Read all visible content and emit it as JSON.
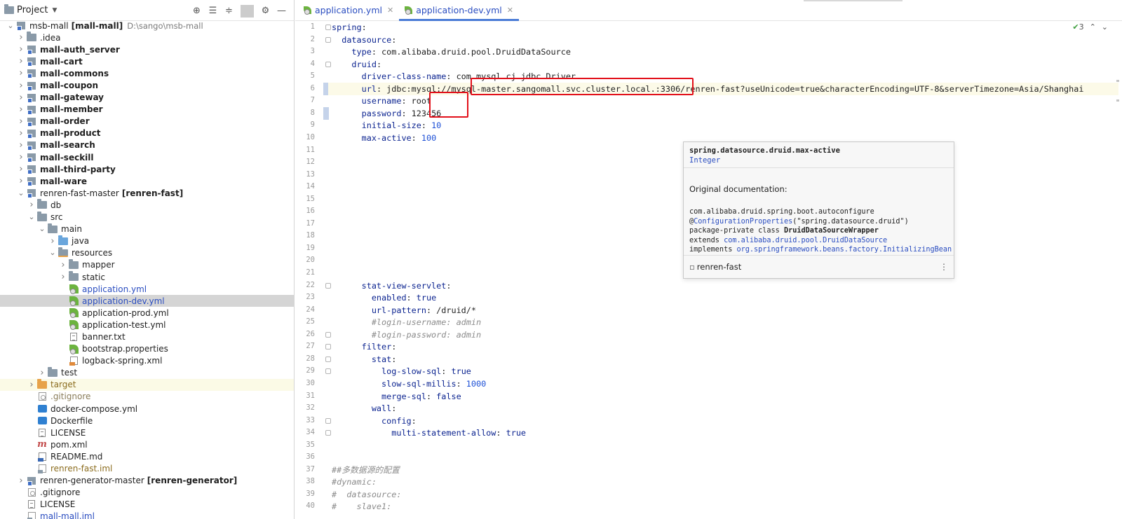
{
  "project_panel": {
    "title": "Project",
    "tools": [
      "locate-icon",
      "expand-all-icon",
      "collapse-all-icon",
      "gear-icon",
      "hide-icon"
    ],
    "tree": [
      {
        "depth": 0,
        "arrow": "open",
        "icon": "module",
        "label": "msb-mall",
        "extra": "[mall-mall]",
        "path": "D:\\sango\\msb-mall",
        "style": ""
      },
      {
        "depth": 1,
        "arrow": "closed",
        "icon": "folder",
        "label": ".idea",
        "style": ""
      },
      {
        "depth": 1,
        "arrow": "closed",
        "icon": "module",
        "label": "mall-auth_server",
        "style": "bold"
      },
      {
        "depth": 1,
        "arrow": "closed",
        "icon": "module",
        "label": "mall-cart",
        "style": "bold"
      },
      {
        "depth": 1,
        "arrow": "closed",
        "icon": "module",
        "label": "mall-commons",
        "style": "bold"
      },
      {
        "depth": 1,
        "arrow": "closed",
        "icon": "module",
        "label": "mall-coupon",
        "style": "bold"
      },
      {
        "depth": 1,
        "arrow": "closed",
        "icon": "module",
        "label": "mall-gateway",
        "style": "bold"
      },
      {
        "depth": 1,
        "arrow": "closed",
        "icon": "module",
        "label": "mall-member",
        "style": "bold"
      },
      {
        "depth": 1,
        "arrow": "closed",
        "icon": "module",
        "label": "mall-order",
        "style": "bold"
      },
      {
        "depth": 1,
        "arrow": "closed",
        "icon": "module",
        "label": "mall-product",
        "style": "bold"
      },
      {
        "depth": 1,
        "arrow": "closed",
        "icon": "module",
        "label": "mall-search",
        "style": "bold"
      },
      {
        "depth": 1,
        "arrow": "closed",
        "icon": "module",
        "label": "mall-seckill",
        "style": "bold"
      },
      {
        "depth": 1,
        "arrow": "closed",
        "icon": "module",
        "label": "mall-third-party",
        "style": "bold"
      },
      {
        "depth": 1,
        "arrow": "closed",
        "icon": "module",
        "label": "mall-ware",
        "style": "bold"
      },
      {
        "depth": 1,
        "arrow": "open",
        "icon": "module",
        "label": "renren-fast-master",
        "extra": "[renren-fast]",
        "style": ""
      },
      {
        "depth": 2,
        "arrow": "closed",
        "icon": "folder",
        "label": "db",
        "style": ""
      },
      {
        "depth": 2,
        "arrow": "open",
        "icon": "folder",
        "label": "src",
        "style": ""
      },
      {
        "depth": 3,
        "arrow": "open",
        "icon": "folder",
        "label": "main",
        "style": ""
      },
      {
        "depth": 4,
        "arrow": "closed",
        "icon": "folder-blue",
        "label": "java",
        "style": ""
      },
      {
        "depth": 4,
        "arrow": "open",
        "icon": "folder-res",
        "label": "resources",
        "style": ""
      },
      {
        "depth": 5,
        "arrow": "closed",
        "icon": "folder",
        "label": "mapper",
        "style": ""
      },
      {
        "depth": 5,
        "arrow": "closed",
        "icon": "folder",
        "label": "static",
        "style": ""
      },
      {
        "depth": 5,
        "arrow": "none",
        "icon": "leaf",
        "label": "application.yml",
        "style": "blue"
      },
      {
        "depth": 5,
        "arrow": "none",
        "icon": "leaf",
        "label": "application-dev.yml",
        "style": "blue",
        "selected": true
      },
      {
        "depth": 5,
        "arrow": "none",
        "icon": "leaf",
        "label": "application-prod.yml",
        "style": ""
      },
      {
        "depth": 5,
        "arrow": "none",
        "icon": "leaf",
        "label": "application-test.yml",
        "style": ""
      },
      {
        "depth": 5,
        "arrow": "none",
        "icon": "txt",
        "label": "banner.txt",
        "style": ""
      },
      {
        "depth": 5,
        "arrow": "none",
        "icon": "leaf",
        "label": "bootstrap.properties",
        "style": ""
      },
      {
        "depth": 5,
        "arrow": "none",
        "icon": "xml",
        "label": "logback-spring.xml",
        "style": ""
      },
      {
        "depth": 3,
        "arrow": "closed",
        "icon": "folder",
        "label": "test",
        "style": ""
      },
      {
        "depth": 2,
        "arrow": "closed",
        "icon": "folder-orange",
        "label": "target",
        "style": "brown",
        "excluded": true
      },
      {
        "depth": 2,
        "arrow": "none",
        "icon": "git",
        "label": ".gitignore",
        "style": "gitignored"
      },
      {
        "depth": 2,
        "arrow": "none",
        "icon": "docker",
        "label": "docker-compose.yml",
        "style": ""
      },
      {
        "depth": 2,
        "arrow": "none",
        "icon": "docker",
        "label": "Dockerfile",
        "style": ""
      },
      {
        "depth": 2,
        "arrow": "none",
        "icon": "txt",
        "label": "LICENSE",
        "style": ""
      },
      {
        "depth": 2,
        "arrow": "none",
        "icon": "maven",
        "label": "pom.xml",
        "style": ""
      },
      {
        "depth": 2,
        "arrow": "none",
        "icon": "md",
        "label": "README.md",
        "style": ""
      },
      {
        "depth": 2,
        "arrow": "none",
        "icon": "iml",
        "label": "renren-fast.iml",
        "style": "brown"
      },
      {
        "depth": 1,
        "arrow": "closed",
        "icon": "module",
        "label": "renren-generator-master",
        "extra": "[renren-generator]",
        "style": ""
      },
      {
        "depth": 1,
        "arrow": "none",
        "icon": "git",
        "label": ".gitignore",
        "style": ""
      },
      {
        "depth": 1,
        "arrow": "none",
        "icon": "txt",
        "label": "LICENSE",
        "style": ""
      },
      {
        "depth": 1,
        "arrow": "none",
        "icon": "iml",
        "label": "mall-mall.iml",
        "style": "blue"
      }
    ]
  },
  "editor": {
    "tabs": [
      {
        "label": "application.yml",
        "active": false
      },
      {
        "label": "application-dev.yml",
        "active": true
      }
    ],
    "inspection": {
      "count": "3"
    },
    "lines": [
      {
        "n": "1",
        "segs": [
          [
            "k",
            "spring"
          ],
          [
            "v",
            ":"
          ]
        ]
      },
      {
        "n": "2",
        "segs": [
          [
            "v",
            "  "
          ],
          [
            "k",
            "datasource"
          ],
          [
            "v",
            ":"
          ]
        ]
      },
      {
        "n": "3",
        "segs": [
          [
            "v",
            "    "
          ],
          [
            "k",
            "type"
          ],
          [
            "v",
            ": com.alibaba.druid.pool.DruidDataSource"
          ]
        ]
      },
      {
        "n": "4",
        "segs": [
          [
            "v",
            "    "
          ],
          [
            "k",
            "druid"
          ],
          [
            "v",
            ":"
          ]
        ]
      },
      {
        "n": "5",
        "segs": [
          [
            "v",
            "      "
          ],
          [
            "k",
            "driver-class-name"
          ],
          [
            "v",
            ": com.mysql.cj.jdbc.Driver"
          ]
        ]
      },
      {
        "n": "6",
        "segs": [
          [
            "v",
            "      "
          ],
          [
            "k",
            "url"
          ],
          [
            "v",
            ": jdbc:mysql://mysql-master.sangomall.svc.cluster.local.:3306/renren-fast?useUnicode=true&characterEncoding=UTF-8&serverTimezone=Asia/Shanghai"
          ]
        ],
        "current": true
      },
      {
        "n": "7",
        "segs": [
          [
            "v",
            "      "
          ],
          [
            "k",
            "username"
          ],
          [
            "v",
            ": root"
          ]
        ]
      },
      {
        "n": "8",
        "segs": [
          [
            "v",
            "      "
          ],
          [
            "k",
            "password"
          ],
          [
            "v",
            ": 123456"
          ]
        ]
      },
      {
        "n": "9",
        "segs": [
          [
            "v",
            "      "
          ],
          [
            "k",
            "initial-size"
          ],
          [
            "v",
            ": "
          ],
          [
            "n",
            "10"
          ]
        ]
      },
      {
        "n": "10",
        "segs": [
          [
            "v",
            "      "
          ],
          [
            "k",
            "max-active"
          ],
          [
            "v",
            ": "
          ],
          [
            "n",
            "100"
          ]
        ]
      },
      {
        "n": "11",
        "segs": []
      },
      {
        "n": "12",
        "segs": []
      },
      {
        "n": "13",
        "segs": []
      },
      {
        "n": "14",
        "segs": []
      },
      {
        "n": "15",
        "segs": []
      },
      {
        "n": "16",
        "segs": []
      },
      {
        "n": "17",
        "segs": []
      },
      {
        "n": "18",
        "segs": []
      },
      {
        "n": "19",
        "segs": []
      },
      {
        "n": "20",
        "segs": []
      },
      {
        "n": "21",
        "segs": []
      },
      {
        "n": "22",
        "segs": [
          [
            "v",
            "      "
          ],
          [
            "k",
            "stat-view-servlet"
          ],
          [
            "v",
            ":"
          ]
        ]
      },
      {
        "n": "23",
        "segs": [
          [
            "v",
            "        "
          ],
          [
            "k",
            "enabled"
          ],
          [
            "v",
            ": "
          ],
          [
            "kw",
            "true"
          ]
        ]
      },
      {
        "n": "24",
        "segs": [
          [
            "v",
            "        "
          ],
          [
            "k",
            "url-pattern"
          ],
          [
            "v",
            ": /druid/*"
          ]
        ]
      },
      {
        "n": "25",
        "segs": [
          [
            "v",
            "        "
          ],
          [
            "c",
            "#login-username: admin"
          ]
        ]
      },
      {
        "n": "26",
        "segs": [
          [
            "v",
            "        "
          ],
          [
            "c",
            "#login-password: admin"
          ]
        ]
      },
      {
        "n": "27",
        "segs": [
          [
            "v",
            "      "
          ],
          [
            "k",
            "filter"
          ],
          [
            "v",
            ":"
          ]
        ]
      },
      {
        "n": "28",
        "segs": [
          [
            "v",
            "        "
          ],
          [
            "k",
            "stat"
          ],
          [
            "v",
            ":"
          ]
        ]
      },
      {
        "n": "29",
        "segs": [
          [
            "v",
            "          "
          ],
          [
            "k",
            "log-slow-sql"
          ],
          [
            "v",
            ": "
          ],
          [
            "kw",
            "true"
          ]
        ]
      },
      {
        "n": "30",
        "segs": [
          [
            "v",
            "          "
          ],
          [
            "k",
            "slow-sql-millis"
          ],
          [
            "v",
            ": "
          ],
          [
            "n",
            "1000"
          ]
        ]
      },
      {
        "n": "31",
        "segs": [
          [
            "v",
            "          "
          ],
          [
            "k",
            "merge-sql"
          ],
          [
            "v",
            ": "
          ],
          [
            "kw",
            "false"
          ]
        ]
      },
      {
        "n": "32",
        "segs": [
          [
            "v",
            "        "
          ],
          [
            "k",
            "wall"
          ],
          [
            "v",
            ":"
          ]
        ]
      },
      {
        "n": "33",
        "segs": [
          [
            "v",
            "          "
          ],
          [
            "k",
            "config"
          ],
          [
            "v",
            ":"
          ]
        ]
      },
      {
        "n": "34",
        "segs": [
          [
            "v",
            "            "
          ],
          [
            "k",
            "multi-statement-allow"
          ],
          [
            "v",
            ": "
          ],
          [
            "kw",
            "true"
          ]
        ]
      },
      {
        "n": "35",
        "segs": []
      },
      {
        "n": "36",
        "segs": []
      },
      {
        "n": "37",
        "segs": [
          [
            "c",
            "##多数据源的配置"
          ]
        ]
      },
      {
        "n": "38",
        "segs": [
          [
            "c",
            "#dynamic:"
          ]
        ]
      },
      {
        "n": "39",
        "segs": [
          [
            "c",
            "#  datasource:"
          ]
        ]
      },
      {
        "n": "40",
        "segs": [
          [
            "c",
            "#    slave1:"
          ]
        ]
      }
    ],
    "popup": {
      "property": "spring.datasource.druid.max-active",
      "type": "Integer",
      "docs_label": "Original documentation:",
      "body": [
        [
          [
            "t",
            "com.alibaba.druid.spring.boot.autoconfigure"
          ]
        ],
        [
          [
            "t",
            "@"
          ],
          [
            "link",
            "ConfigurationProperties"
          ],
          [
            "t",
            "(\"spring.datasource.druid\")"
          ]
        ],
        [
          [
            "t",
            "package-private class "
          ],
          [
            "b",
            "DruidDataSourceWrapper"
          ]
        ],
        [
          [
            "t",
            "extends "
          ],
          [
            "link",
            "com.alibaba.druid.pool.DruidDataSource"
          ]
        ],
        [
          [
            "t",
            "implements "
          ],
          [
            "link",
            "org.springframework.beans.factory.InitializingBean"
          ]
        ]
      ],
      "module": "renren-fast"
    }
  }
}
